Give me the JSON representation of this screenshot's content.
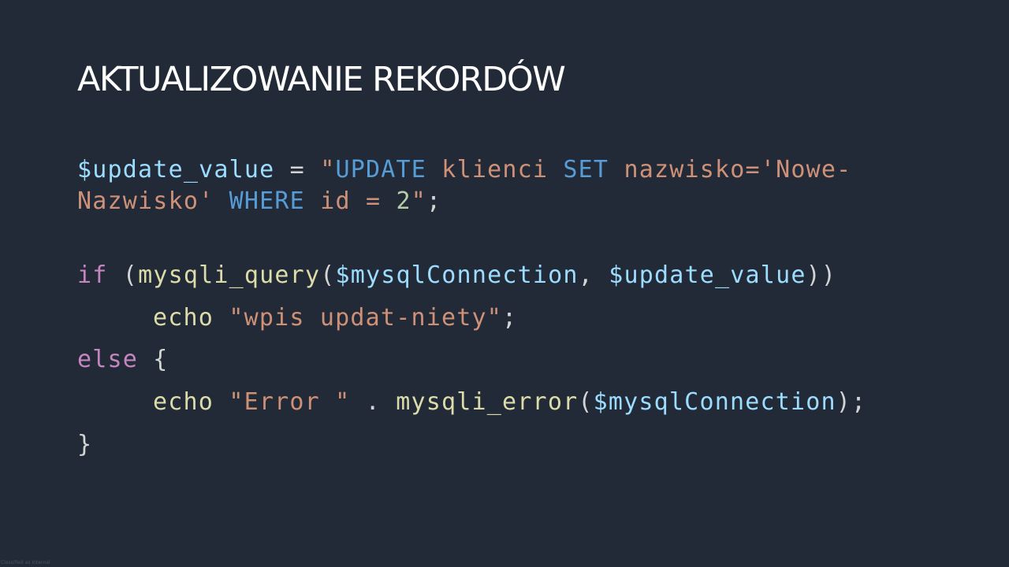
{
  "slide": {
    "title": "AKTUALIZOWANIE REKORDÓW",
    "footer": "Classified as Internal"
  },
  "code": {
    "line1": {
      "var": "$update_value",
      "assign": " = ",
      "str_open": "\"",
      "kw_update": "UPDATE",
      "str_table": " klienci ",
      "kw_set": "SET",
      "str_set": " nazwisko='Nowe-"
    },
    "line2": {
      "str_value": "Nazwisko' ",
      "kw_where": "WHERE",
      "str_id": " id = ",
      "num": "2",
      "str_close": "\"",
      "end": ";"
    },
    "line3": {
      "kw_if": "if",
      "open": " (",
      "fn": "mysqli_query",
      "paren": "(",
      "arg1": "$mysqlConnection",
      "comma": ", ",
      "arg2": "$update_value",
      "close": "))"
    },
    "line4": {
      "fn": "echo",
      "space": " ",
      "str": "\"wpis updat-niety\"",
      "end": ";"
    },
    "line5": {
      "kw_else": "else",
      "brace": " {"
    },
    "line6": {
      "fn": "echo",
      "space": " ",
      "str": "\"Error \"",
      "concat": " . ",
      "fn2": "mysqli_error",
      "paren": "(",
      "arg": "$mysqlConnection",
      "end": ");"
    },
    "line7": {
      "brace": "}"
    }
  }
}
